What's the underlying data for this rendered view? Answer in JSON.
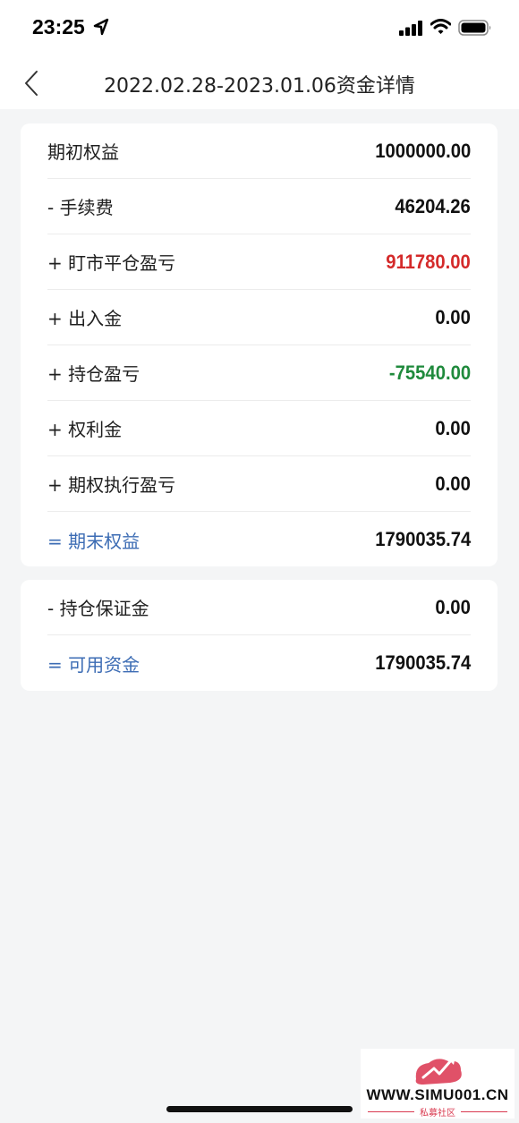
{
  "status_bar": {
    "time": "23:25",
    "icons": [
      "location-arrow-icon",
      "cellular-signal-icon",
      "wifi-icon",
      "battery-icon"
    ]
  },
  "nav": {
    "back_icon": "chevron-left-icon",
    "title": "2022.02.28-2023.01.06资金详情"
  },
  "colors": {
    "loss_red": "#d42a2a",
    "gain_green": "#1f8a3c",
    "total_blue": "#3c6cb4"
  },
  "equity_card": {
    "rows": [
      {
        "label": "期初权益",
        "value": "1000000.00"
      },
      {
        "label": "- 手续费",
        "value": "46204.26"
      },
      {
        "label": "+ 盯市平仓盈亏",
        "value": "911780.00"
      },
      {
        "label": "+ 出入金",
        "value": "0.00"
      },
      {
        "label": "+ 持仓盈亏",
        "value": "-75540.00"
      },
      {
        "label": "+ 权利金",
        "value": "0.00"
      },
      {
        "label": "+ 期权执行盈亏",
        "value": "0.00"
      },
      {
        "label": "= 期末权益",
        "value": "1790035.74"
      }
    ]
  },
  "available_card": {
    "rows": [
      {
        "label": "- 持仓保证金",
        "value": "0.00"
      },
      {
        "label": "= 可用资金",
        "value": "1790035.74"
      }
    ]
  },
  "watermark": {
    "site": "WWW.SIMU001.CN",
    "subtitle": "私募社区"
  }
}
